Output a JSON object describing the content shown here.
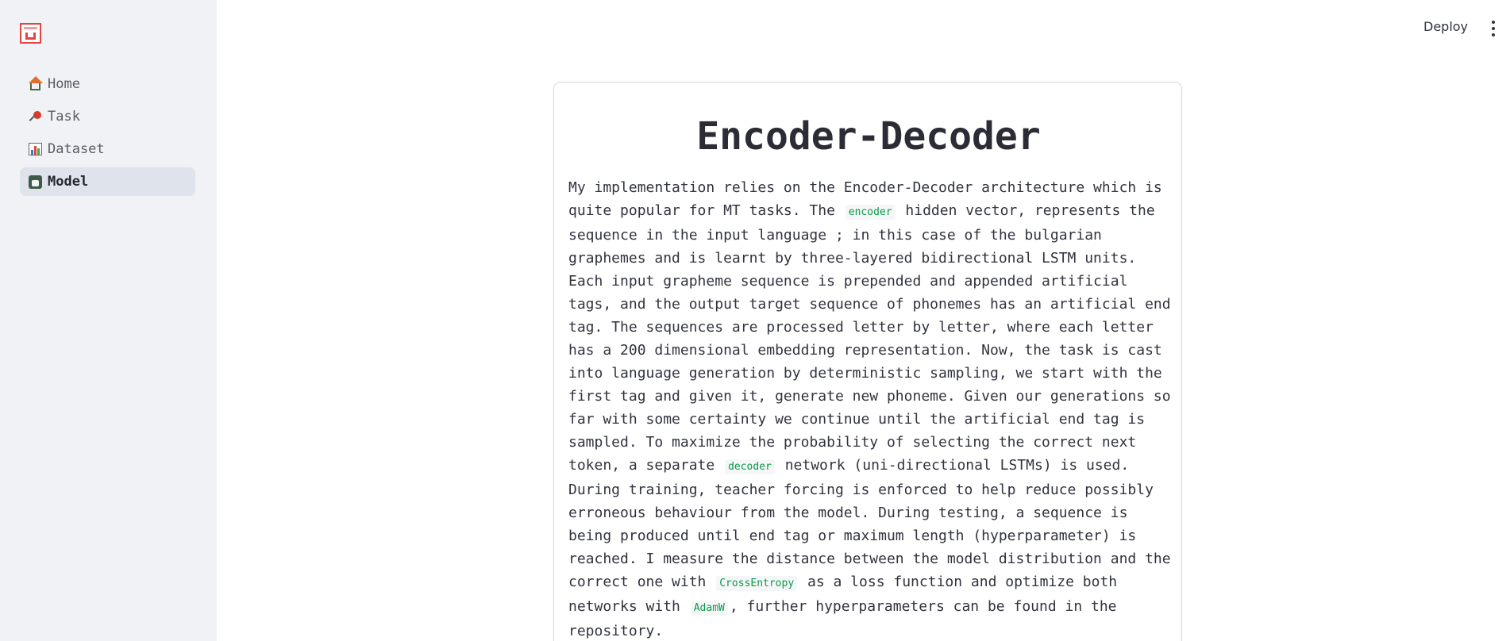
{
  "sidebar": {
    "logo_icon": "streamlit-logo-icon",
    "items": [
      {
        "label": "Home",
        "icon": "house-icon",
        "active": false
      },
      {
        "label": "Task",
        "icon": "pushpin-icon",
        "active": false
      },
      {
        "label": "Dataset",
        "icon": "bar-chart-icon",
        "active": false
      },
      {
        "label": "Model",
        "icon": "model-icon",
        "active": true
      }
    ]
  },
  "header": {
    "deploy_label": "Deploy",
    "menu_icon": "kebab-menu-icon"
  },
  "main": {
    "title": "Encoder-Decoder",
    "paragraph": {
      "t1": "My implementation relies on the Encoder-Decoder architecture which is quite popular for MT tasks. The ",
      "c1": "encoder",
      "t2": " hidden vector, represents the sequence in the input language ; in this case of the bulgarian graphemes and is learnt by three-layered bidirectional LSTM units. Each input grapheme sequence is prepended and appended artificial tags, and the output target sequence of phonemes has an artificial end tag. The sequences are processed letter by letter, where each letter has a 200 dimensional embedding representation. Now, the task is cast into language generation by deterministic sampling, we start with the first tag and given it, generate new phoneme. Given our generations so far with some certainty we continue until the artificial end tag is sampled. To maximize the probability of selecting the correct next token, a separate ",
      "c2": "decoder",
      "t3": " network (uni-directional LSTMs) is used. During training, teacher forcing is enforced to help reduce possibly erroneous behaviour from the model. During testing, a sequence is being produced until end tag or maximum length (hyperparameter) is reached. I measure the distance between the model distribution and the correct one with ",
      "c3": "CrossEntropy",
      "t4": " as a loss function and optimize both networks with ",
      "c4": "AdamW",
      "t5": ", further hyperparameters can be found in the repository."
    }
  },
  "colors": {
    "sidebar_bg": "#f0f2f6",
    "active_item_bg": "#dfe3ec",
    "text": "#31333f",
    "code_green": "#0c9a48",
    "logo_red": "#e34545"
  }
}
